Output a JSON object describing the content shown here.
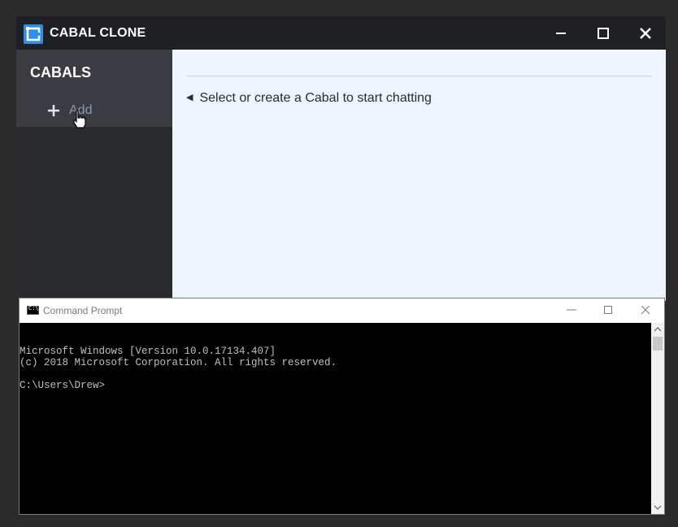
{
  "cabal_window": {
    "title": "CABAL CLONE",
    "sidebar": {
      "heading": "CABALS",
      "add_label": "Add"
    },
    "main": {
      "prompt": "Select or create a Cabal to start chatting"
    },
    "colors": {
      "titlebar": "#1f2023",
      "sidebar": "#2a2b2e",
      "sidebar_header": "#3a3c41",
      "accent": "#2d8fe8",
      "main_bg": "#eef5ff"
    }
  },
  "cmd_window": {
    "title": "Command Prompt",
    "lines": [
      "Microsoft Windows [Version 10.0.17134.407]",
      "(c) 2018 Microsoft Corporation. All rights reserved.",
      "",
      "C:\\Users\\Drew>"
    ]
  }
}
